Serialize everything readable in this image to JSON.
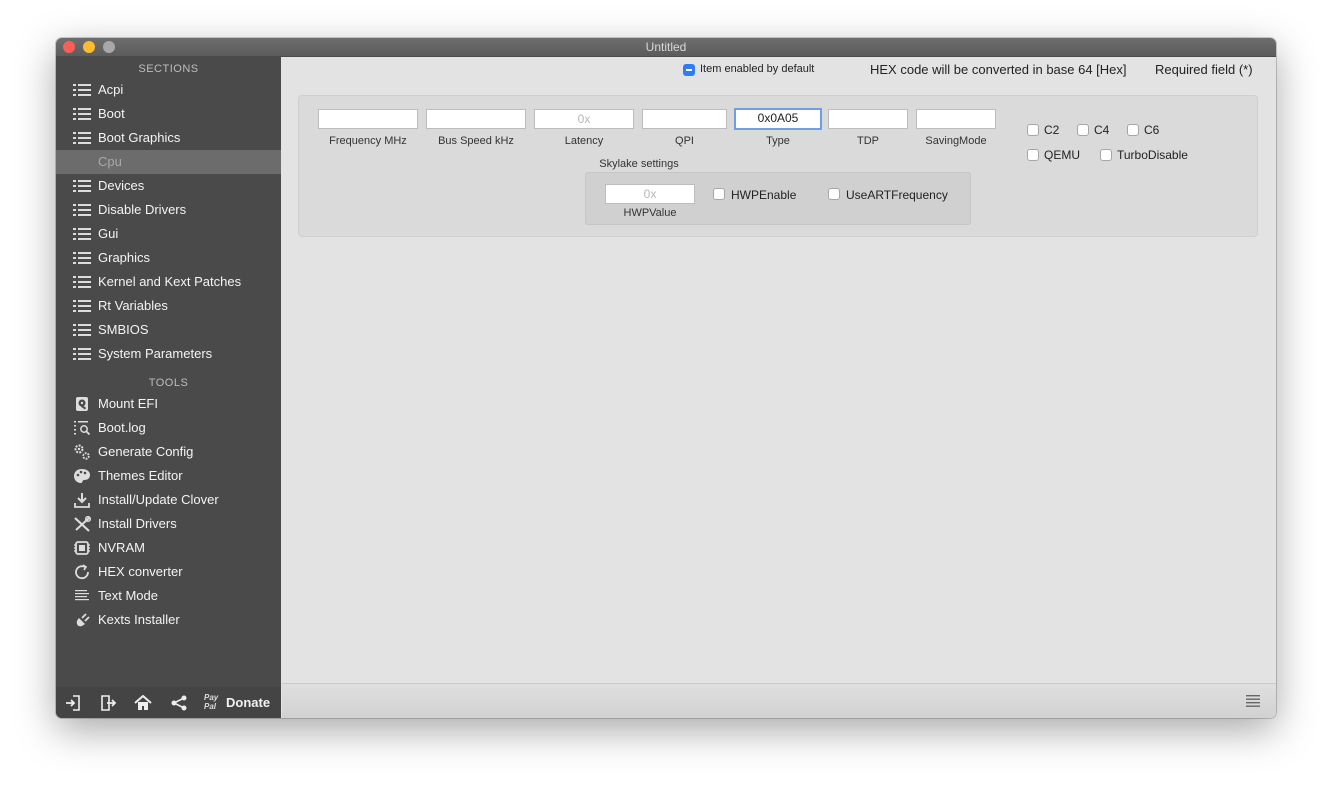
{
  "window": {
    "title": "Untitled"
  },
  "sidebar": {
    "sections_header": "SECTIONS",
    "sections": [
      {
        "label": "Acpi",
        "icon": "list-icon"
      },
      {
        "label": "Boot",
        "icon": "list-icon"
      },
      {
        "label": "Boot Graphics",
        "icon": "list-icon"
      },
      {
        "label": "Cpu",
        "icon": "none",
        "active": true
      },
      {
        "label": "Devices",
        "icon": "list-icon"
      },
      {
        "label": "Disable Drivers",
        "icon": "list-icon"
      },
      {
        "label": "Gui",
        "icon": "list-icon"
      },
      {
        "label": "Graphics",
        "icon": "list-icon"
      },
      {
        "label": "Kernel and Kext Patches",
        "icon": "list-icon"
      },
      {
        "label": "Rt Variables",
        "icon": "list-icon"
      },
      {
        "label": "SMBIOS",
        "icon": "list-icon"
      },
      {
        "label": "System Parameters",
        "icon": "list-icon"
      }
    ],
    "tools_header": "TOOLS",
    "tools": [
      {
        "label": "Mount EFI",
        "icon": "disk-icon"
      },
      {
        "label": "Boot.log",
        "icon": "log-search-icon"
      },
      {
        "label": "Generate Config",
        "icon": "gears-icon"
      },
      {
        "label": "Themes Editor",
        "icon": "palette-icon"
      },
      {
        "label": "Install/Update Clover",
        "icon": "download-icon"
      },
      {
        "label": "Install Drivers",
        "icon": "tools-icon"
      },
      {
        "label": "NVRAM",
        "icon": "chip-icon"
      },
      {
        "label": "HEX converter",
        "icon": "refresh-icon"
      },
      {
        "label": "Text Mode",
        "icon": "text-lines-icon"
      },
      {
        "label": "Kexts Installer",
        "icon": "plug-icon"
      }
    ],
    "bottom": {
      "icons": [
        "import-icon",
        "export-icon",
        "home-icon",
        "share-icon"
      ],
      "paypal_text": "Pay Pal",
      "donate_label": "Donate"
    }
  },
  "header": {
    "enabled_default_label": "Item enabled by default",
    "hex_note": "HEX code will be converted in base 64 [Hex]",
    "required_note": "Required field (*)"
  },
  "cpu": {
    "fields": [
      {
        "label": "Frequency MHz",
        "value": ""
      },
      {
        "label": "Bus Speed kHz",
        "value": ""
      },
      {
        "label": "Latency",
        "value": "",
        "placeholder": "0x"
      },
      {
        "label": "QPI",
        "value": ""
      },
      {
        "label": "Type",
        "value": "0x0A05"
      },
      {
        "label": "TDP",
        "value": ""
      },
      {
        "label": "SavingMode",
        "value": ""
      }
    ],
    "checkboxes": [
      {
        "label": "C2",
        "checked": false
      },
      {
        "label": "C4",
        "checked": false
      },
      {
        "label": "C6",
        "checked": false
      },
      {
        "label": "QEMU",
        "checked": false
      },
      {
        "label": "TurboDisable",
        "checked": false
      }
    ],
    "skylake": {
      "title": "Skylake settings",
      "hwp_value_label": "HWPValue",
      "hwp_value_placeholder": "0x",
      "hwp_enable_label": "HWPEnable",
      "use_art_label": "UseARTFrequency"
    }
  },
  "colors": {
    "sidebar_bg": "#4a4a4a",
    "active_item": "#6c6c6c",
    "accent": "#2f7cf6"
  }
}
